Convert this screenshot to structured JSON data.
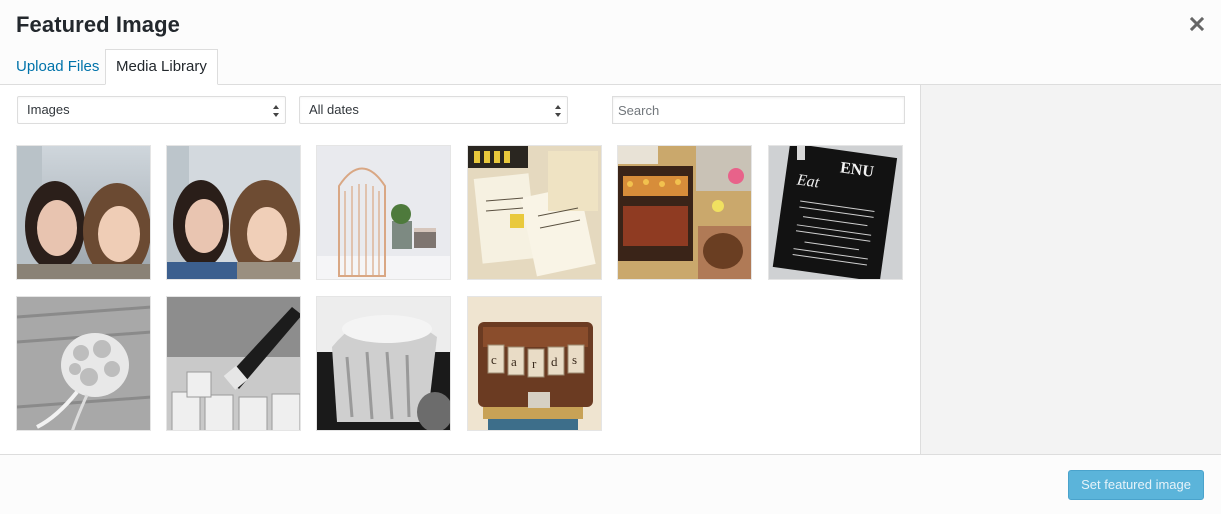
{
  "modal": {
    "title": "Featured Image"
  },
  "tabs": [
    {
      "label": "Upload Files",
      "active": false
    },
    {
      "label": "Media Library",
      "active": true
    }
  ],
  "filters": {
    "type_selected": "Images",
    "date_selected": "All dates"
  },
  "search": {
    "placeholder": "Search"
  },
  "media": [
    {
      "subject": "selfie of two women"
    },
    {
      "subject": "selfie of two women"
    },
    {
      "subject": "gold birdcage on shelf"
    },
    {
      "subject": "wedding stationery"
    },
    {
      "subject": "venue collage"
    },
    {
      "subject": "chalkboard menu card"
    },
    {
      "subject": "bouquet black and white"
    },
    {
      "subject": "champagne pouring black and white"
    },
    {
      "subject": "cupcake black and white"
    },
    {
      "subject": "vintage suitcase with cards bunting"
    }
  ],
  "footer": {
    "primary_button": "Set featured image"
  },
  "colors": {
    "link": "#0073aa",
    "primary_button": "#5bb4da"
  }
}
